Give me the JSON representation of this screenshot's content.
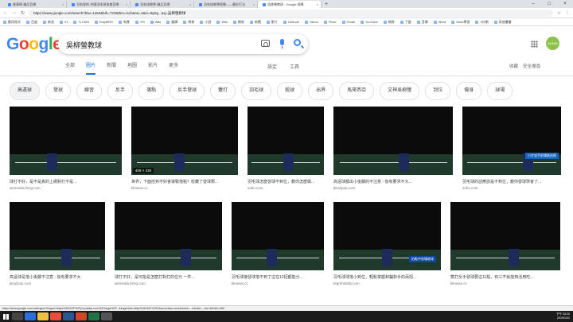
{
  "browser": {
    "tabs": [
      {
        "title": "美華德-聯品官網",
        "active": false
      },
      {
        "title": "羽毛球的-中國羽毛球協會官網",
        "active": false
      },
      {
        "title": "羽毛球教學-聯品官網",
        "active": false
      },
      {
        "title": "羽毛球教學經驗——最好打法",
        "active": false
      },
      {
        "title": "吳柳螢教球 - Google 搜尋",
        "active": true
      }
    ],
    "url": "https://www.google.com/search?biw=1463&bih=723&tbm=isch&sa=1&ei=8qSg...&q=吳柳螢教球",
    "bookmarks": [
      "應用程式",
      "百度",
      "新浪",
      "21",
      "Ti-CMS",
      "SnipMRS",
      "淘寶",
      "YM",
      "Wiki",
      "翻譯",
      "問卷",
      "小說",
      "Wiki",
      "網易",
      "新聞",
      "影片",
      "Outlook",
      "Yahoo",
      "Flickr",
      "Gmail",
      "YouTube",
      "網頁",
      "下載",
      "音樂",
      "Word",
      "Work學習",
      "9分類",
      "其他書籤"
    ]
  },
  "google": {
    "logo": "Google",
    "query": "吳柳螢教球",
    "nav_tabs": [
      "全部",
      "圖片",
      "新聞",
      "地圖",
      "影片",
      "更多"
    ],
    "active_tab": "圖片",
    "tools": [
      "設定",
      "工具"
    ],
    "right_nav": [
      "收藏",
      "安全搜尋"
    ],
    "avatar_text": "ADMIN"
  },
  "chips": [
    "高遠球",
    "發球",
    "練習",
    "反手",
    "落點",
    "反手發球",
    "雙打",
    "羽毛球",
    "殺球",
    "出界",
    "馬來西亞",
    "文神吳柳螢",
    "到位",
    "傷身",
    "球場"
  ],
  "results_row1": [
    {
      "caption": "球打不好，是不是真的上網對打不是...",
      "source": "wemedia.ifeng.com",
      "dims": ""
    },
    {
      "caption": "世界，下面控到不好會導致落點？收藏了發球那...",
      "source": "kknews.cc",
      "dims": "408 × 230"
    },
    {
      "caption": "羽毛球怎麼發球不到位，教你怎麼做...",
      "source": "sohu.com",
      "dims": ""
    },
    {
      "caption": "高遠球都出小後腳的不注意 - 後有要求不大...",
      "source": "jktodyvip.com",
      "dims": ""
    },
    {
      "caption": "羽毛球的話應該是不到位，教你發球學會了...",
      "source": "sohu.com",
      "dims": ""
    }
  ],
  "results_row2": [
    {
      "caption": "高遠球是落小後腳不注意 - 後有要求不大",
      "source": "jktodyvip.com"
    },
    {
      "caption": "球打不好，是可能是怎麼打對打的位元 一件...",
      "source": "wemedia.ifeng.com"
    },
    {
      "caption": "羽毛球接發球落不到了這在10招都能分...",
      "source": "kknews.cc"
    },
    {
      "caption": "羽毛球球落小到位，輕鬆掌握和騙對手的兩招...",
      "source": "tegrehtdaily.com"
    },
    {
      "caption": "雙打反手發球要這11點，有三不就能夠活用吃...",
      "source": "kknews.cc"
    }
  ],
  "banners": [
    "小步攻手前場挑技術",
    "拍點中前場收球"
  ],
  "status_url": "https://www.google.com.tw/imgres?imgurl=https%3A%2F%2Fp3.pstatp.com%2Flarge%2F...&imgrefurl=https%3A%2F%2Fwww.toutiao.com&docid=...&tbnid=...&w=640&h=360",
  "tray": {
    "time": "下午 03:20",
    "date": "2019/1/31"
  }
}
